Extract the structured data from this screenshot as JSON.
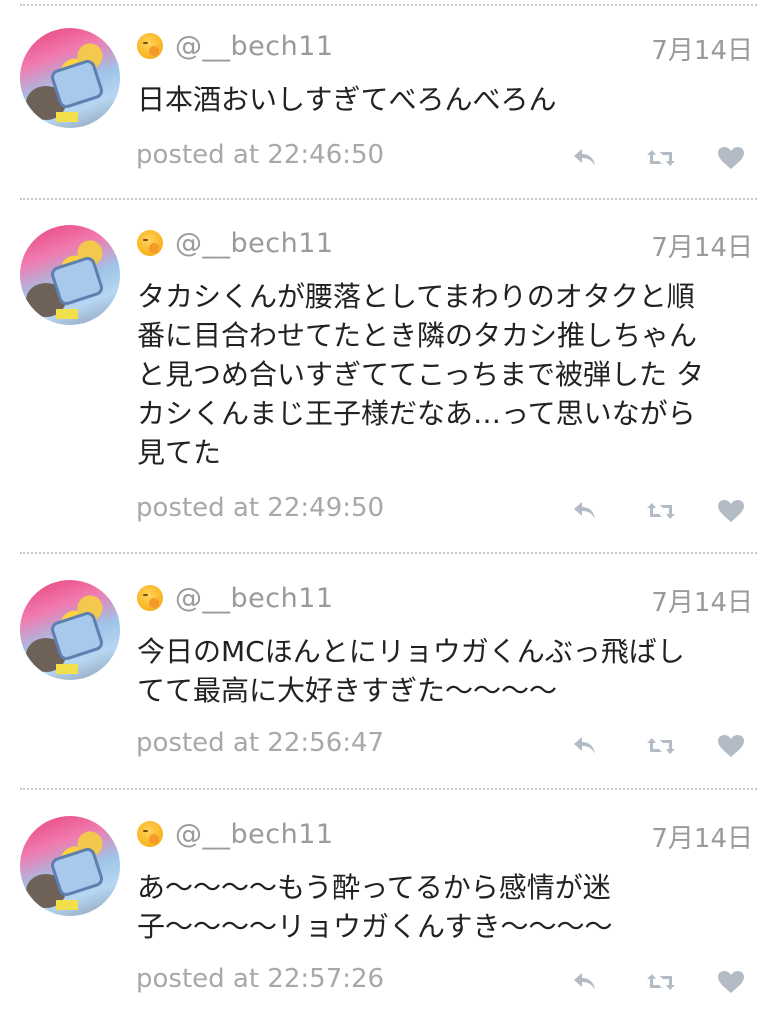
{
  "colors": {
    "text": "#222222",
    "muted": "#9a9a9a",
    "icon": "#b3bcc5",
    "divider": "#c8c8c8"
  },
  "tweets": [
    {
      "username": "@__bech11",
      "date": "7月14日",
      "text": "日本酒おいしすぎてべろんべろん",
      "posted": "posted at 22:46:50",
      "icons": [
        "reply-icon",
        "retweet-icon",
        "heart-icon"
      ]
    },
    {
      "username": "@__bech11",
      "date": "7月14日",
      "text": "タカシくんが腰落としてまわりのオタクと順\n番に目合わせてたとき隣のタカシ推しちゃん\nと見つめ合いすぎててこっちまで被弾した タ\nカシくんまじ王子様だなあ…って思いながら\n見てた",
      "posted": "posted at 22:49:50",
      "icons": [
        "reply-icon",
        "retweet-icon",
        "heart-icon"
      ]
    },
    {
      "username": "@__bech11",
      "date": "7月14日",
      "text": "今日のMCほんとにリョウガくんぶっ飛ばし\nてて最高に大好きすぎた〜〜〜〜",
      "posted": "posted at 22:56:47",
      "icons": [
        "reply-icon",
        "retweet-icon",
        "heart-icon"
      ]
    },
    {
      "username": "@__bech11",
      "date": "7月14日",
      "text": "あ〜〜〜〜もう酔ってるから感情が迷\n子〜〜〜〜リョウガくんすき〜〜〜〜",
      "posted": "posted at 22:57:26",
      "icons": [
        "reply-icon",
        "retweet-icon",
        "heart-icon"
      ]
    }
  ]
}
